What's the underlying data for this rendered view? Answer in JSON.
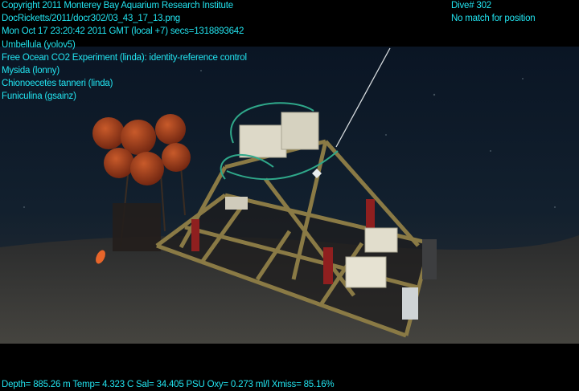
{
  "overlay": {
    "left_lines": [
      "Copyright 2011 Monterey Bay Aquarium Research Institute",
      "DocRicketts/2011/docr302/03_43_17_13.png",
      "Mon Oct 17 23:20:42 2011 GMT (local +7)  secs=1318893642",
      "Umbellula (yolov5)",
      "Free Ocean CO2 Experiment (linda): identity-reference control",
      "Mysida (lonny)",
      "Chionoecetes tanneri (linda)",
      "Funiculina (gsainz)"
    ],
    "right_lines": [
      "Dive# 302",
      "No match for position"
    ],
    "bottom_line": "Depth= 885.26 m  Temp= 4.323 C  Sal= 34.405 PSU  Oxy= 0.273 ml/l  Xmiss= 85.16%"
  },
  "colors": {
    "overlay_text": "#22e4f0",
    "water": "#0b1a2a",
    "seafloor": "#3a3a38",
    "frame": "#8a7a45",
    "floats": "#a5421d",
    "panels": "#8f1f1f"
  }
}
